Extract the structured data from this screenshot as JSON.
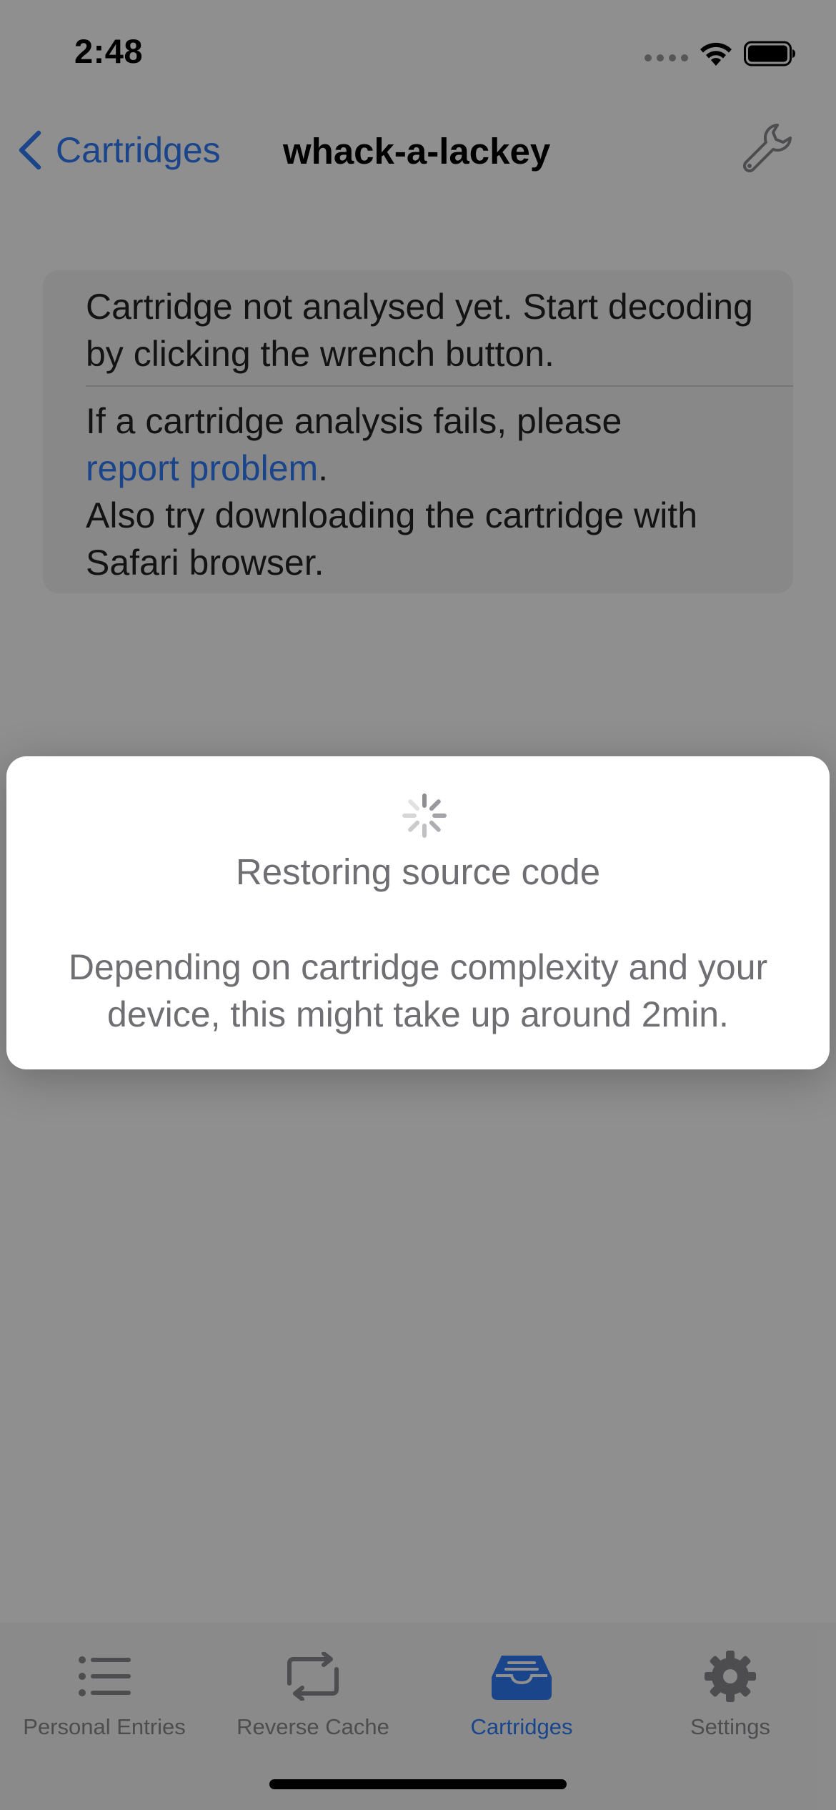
{
  "status_bar": {
    "time": "2:48"
  },
  "nav": {
    "back_label": "Cartridges",
    "title": "whack-a-lackey"
  },
  "info_card": {
    "line1": "Cartridge not analysed yet. Start decoding by clicking the wrench button.",
    "fail_prefix": "If a cartridge analysis fails, please",
    "report_link": "report problem",
    "report_suffix": ".",
    "safari_hint": "Also try downloading the cartridge with Safari browser."
  },
  "hud": {
    "title": "Restoring source code",
    "message": "Depending on cartridge complexity and your device, this might take up around 2min."
  },
  "tabs": [
    {
      "label": "Personal Entries",
      "icon": "list-icon",
      "active": false
    },
    {
      "label": "Reverse Cache",
      "icon": "repeat-icon",
      "active": false
    },
    {
      "label": "Cartridges",
      "icon": "tray-icon",
      "active": true
    },
    {
      "label": "Settings",
      "icon": "gear-icon",
      "active": false
    }
  ],
  "colors": {
    "accent": "#2f7cf6",
    "inactive": "#8a8a8e",
    "overlay": "rgba(0,0,0,0.44)"
  }
}
